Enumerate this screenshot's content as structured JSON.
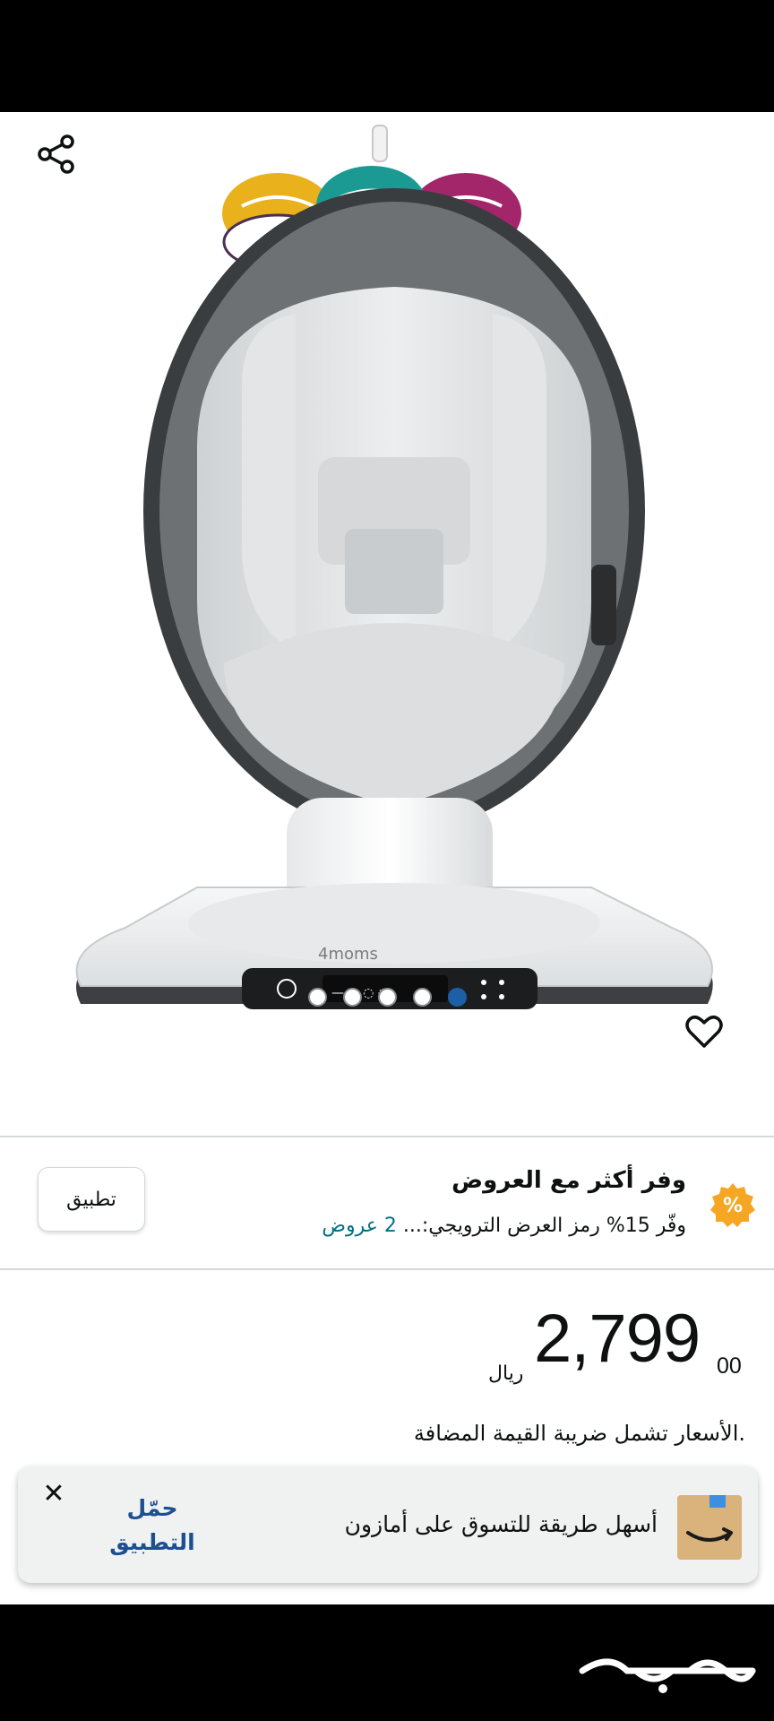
{
  "gallery": {
    "share_icon": "share-icon",
    "wishlist_icon": "heart-icon",
    "dots_count": 5,
    "active_dot": 4
  },
  "product_image": {
    "brand_text": "4moms"
  },
  "offers": {
    "title": "وفر أكثر مع العروض",
    "subtitle": "وفّر 15% رمز العرض الترويجي:... ",
    "link": "2 عروض",
    "apply_label": "تطبيق",
    "badge_icon": "percent-badge-icon",
    "badge_color": "#f5a623"
  },
  "price": {
    "whole": "2,799",
    "fraction": "00",
    "currency": "ريال",
    "vat_note": ".الأسعار تشمل ضريبة القيمة المضافة"
  },
  "app_banner": {
    "close_label": "✕",
    "download_line1": "حمّل",
    "download_line2": "التطبيق",
    "message": "أسهل طريقة للتسوق على أمازون",
    "accent_color": "#1d4f91"
  },
  "watermark": {
    "text": "حراج"
  }
}
